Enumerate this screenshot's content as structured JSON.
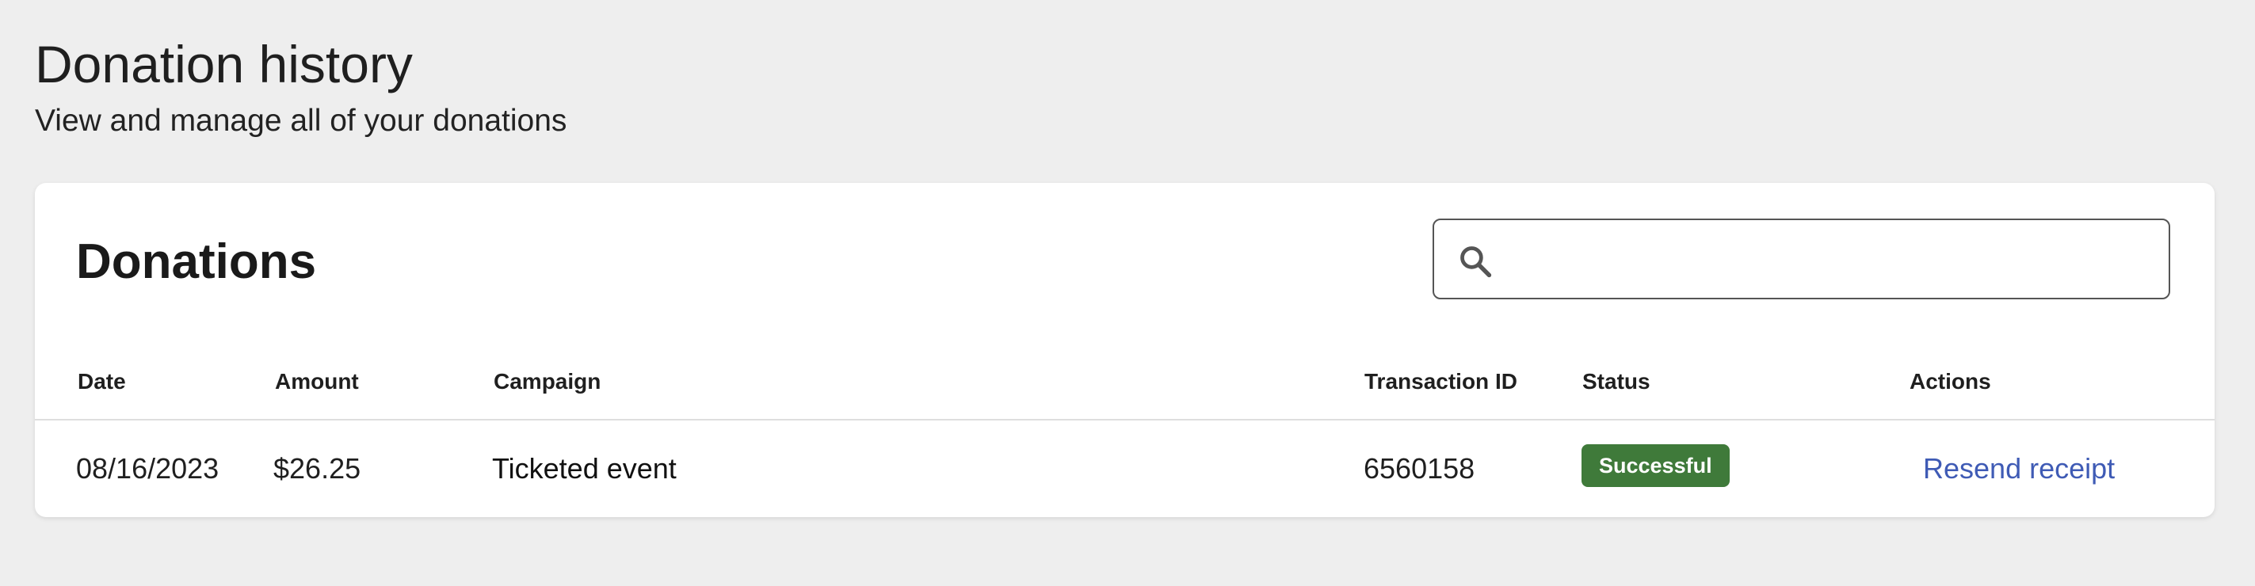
{
  "page": {
    "title": "Donation history",
    "subtitle": "View and manage all of your donations"
  },
  "card": {
    "title": "Donations",
    "search": {
      "value": "",
      "placeholder": "",
      "icon": "search-icon"
    }
  },
  "table": {
    "columns": [
      "Date",
      "Amount",
      "Campaign",
      "Transaction ID",
      "Status",
      "Actions"
    ],
    "rows": [
      {
        "date": "08/16/2023",
        "amount": "$26.25",
        "campaign": "Ticketed event",
        "transaction_id": "6560158",
        "status": "Successful",
        "action": "Resend receipt"
      }
    ]
  },
  "colors": {
    "background": "#eeeeee",
    "card": "#ffffff",
    "status_success": "#3f7a3a",
    "link": "#3f5bb5"
  }
}
